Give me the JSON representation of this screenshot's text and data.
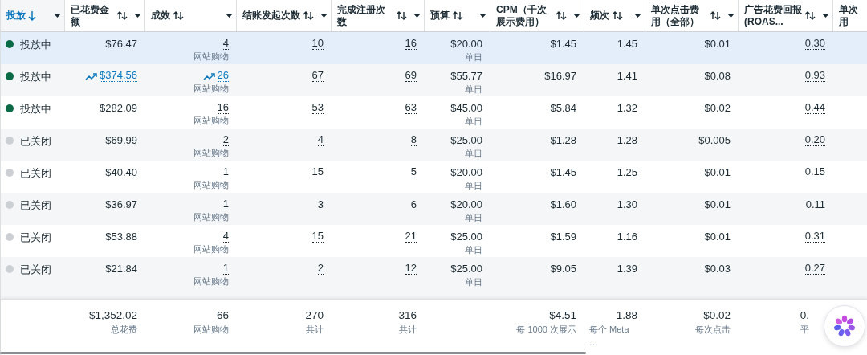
{
  "columns": [
    {
      "label": "投放",
      "sorted": true,
      "sortable": false
    },
    {
      "label": "已花费金额",
      "sorted": false,
      "sortable": true
    },
    {
      "label": "成效",
      "sorted": false,
      "sortable": true
    },
    {
      "label": "结账发起次数",
      "sorted": false,
      "sortable": true
    },
    {
      "label": "完成注册次数",
      "sorted": false,
      "sortable": true
    },
    {
      "label": "预算",
      "sorted": false,
      "sortable": true
    },
    {
      "label": "CPM（千次展示费用）",
      "sorted": false,
      "sortable": true
    },
    {
      "label": "频次",
      "sorted": false,
      "sortable": true
    },
    {
      "label": "单次点击费用（全部）",
      "sorted": false,
      "sortable": true
    },
    {
      "label": "广告花费回报 (ROAS...",
      "sorted": false,
      "sortable": true
    },
    {
      "label": "单次用",
      "sorted": false,
      "sortable": false
    }
  ],
  "rows": [
    {
      "selected": true,
      "active": true,
      "status": "投放中",
      "spend": "$76.47",
      "trending": false,
      "results": "4",
      "result_type": "网站购物",
      "checkouts": "10",
      "registrations": "16",
      "budget": "$20.00",
      "budget_type": "单日",
      "cpm": "$1.45",
      "frequency": "1.45",
      "cpc": "$0.01",
      "roas": "0.30",
      "detail_links": true
    },
    {
      "selected": false,
      "active": true,
      "status": "投放中",
      "spend": "$374.56",
      "trending": true,
      "results": "26",
      "result_type": "网站购物",
      "checkouts": "67",
      "registrations": "69",
      "budget": "$55.77",
      "budget_type": "单日",
      "cpm": "$16.97",
      "frequency": "1.41",
      "cpc": "$0.08",
      "roas": "0.93",
      "detail_links": true
    },
    {
      "selected": false,
      "active": true,
      "status": "投放中",
      "spend": "$282.09",
      "trending": false,
      "results": "16",
      "result_type": "网站购物",
      "checkouts": "53",
      "registrations": "63",
      "budget": "$45.00",
      "budget_type": "单日",
      "cpm": "$5.84",
      "frequency": "1.32",
      "cpc": "$0.02",
      "roas": "0.44",
      "detail_links": true
    },
    {
      "selected": false,
      "active": false,
      "status": "已关闭",
      "spend": "$69.99",
      "trending": false,
      "results": "2",
      "result_type": "网站购物",
      "checkouts": "4",
      "registrations": "8",
      "budget": "$25.00",
      "budget_type": "单日",
      "cpm": "$1.28",
      "frequency": "1.28",
      "cpc": "$0.005",
      "roas": "0.20",
      "detail_links": true
    },
    {
      "selected": false,
      "active": false,
      "status": "已关闭",
      "spend": "$40.40",
      "trending": false,
      "results": "1",
      "result_type": "网站购物",
      "checkouts": "15",
      "registrations": "5",
      "budget": "$20.00",
      "budget_type": "单日",
      "cpm": "$1.45",
      "frequency": "1.25",
      "cpc": "$0.01",
      "roas": "0.15",
      "detail_links": true
    },
    {
      "selected": false,
      "active": false,
      "status": "已关闭",
      "spend": "$36.97",
      "trending": false,
      "results": "1",
      "result_type": "网站购物",
      "checkouts": "3",
      "registrations": "6",
      "budget": "$20.00",
      "budget_type": "单日",
      "cpm": "$1.60",
      "frequency": "1.30",
      "cpc": "$0.01",
      "roas": "0.11",
      "detail_links": false
    },
    {
      "selected": false,
      "active": false,
      "status": "已关闭",
      "spend": "$53.88",
      "trending": false,
      "results": "4",
      "result_type": "网站购物",
      "checkouts": "15",
      "registrations": "21",
      "budget": "$25.00",
      "budget_type": "单日",
      "cpm": "$1.59",
      "frequency": "1.16",
      "cpc": "$0.01",
      "roas": "0.31",
      "detail_links": true
    },
    {
      "selected": false,
      "active": false,
      "status": "已关闭",
      "spend": "$21.84",
      "trending": false,
      "results": "1",
      "result_type": "网站购物",
      "checkouts": "2",
      "registrations": "12",
      "budget": "$25.00",
      "budget_type": "单日",
      "cpm": "$9.05",
      "frequency": "1.39",
      "cpc": "$0.03",
      "roas": "0.27",
      "detail_links": true
    }
  ],
  "summary": [
    {
      "kind": "blank"
    },
    {
      "kind": "total",
      "value": "$1,352.02",
      "label": "总花费"
    },
    {
      "kind": "total",
      "value": "66",
      "label": "网站购物"
    },
    {
      "kind": "total",
      "value": "270",
      "label": "共计"
    },
    {
      "kind": "total",
      "value": "316",
      "label": "共计"
    },
    {
      "kind": "blank"
    },
    {
      "kind": "total",
      "value": "$4.51",
      "label": "每 1000 次展示"
    },
    {
      "kind": "total",
      "value": "1.88",
      "label": "每个 Meta …"
    },
    {
      "kind": "total",
      "value": "$0.02",
      "label": "每次点击"
    },
    {
      "kind": "total",
      "value": "0.",
      "label": "平"
    }
  ]
}
